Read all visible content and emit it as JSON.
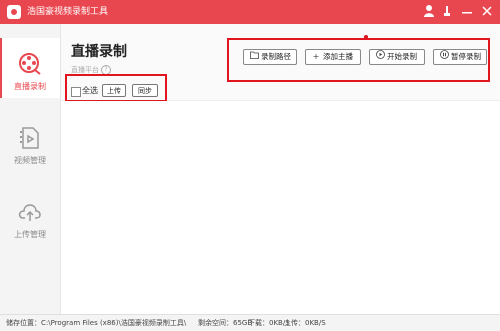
{
  "window": {
    "title": "浩国豪视频录制工具",
    "controls": [
      "user-icon",
      "settings-icon",
      "minimize-icon",
      "close-icon"
    ]
  },
  "sidebar": {
    "items": [
      {
        "label": "直播录制",
        "icon": "film-reel-icon",
        "active": true
      },
      {
        "label": "视频管理",
        "icon": "video-file-icon",
        "active": false
      },
      {
        "label": "上传管理",
        "icon": "cloud-upload-icon",
        "active": false
      }
    ]
  },
  "header": {
    "title": "直播录制",
    "subtitle": "直播平台"
  },
  "selection": {
    "select_all": "全选",
    "upload": "上传",
    "sync": "同步"
  },
  "toolbar": {
    "record_path": "录制路径",
    "add_host": "添加主播",
    "start_record": "开始录制",
    "pause_record": "暂停录制"
  },
  "status": {
    "storage_location": "储存位置：C:\\Program Files (x86)\\浩国豪视频录制工具\\",
    "free_space": "剩余空间：65GB",
    "download": "下载：0KB/S",
    "upload": "上传：0KB/S"
  },
  "colors": {
    "accent": "#e8474f",
    "highlight": "#e0151e"
  }
}
